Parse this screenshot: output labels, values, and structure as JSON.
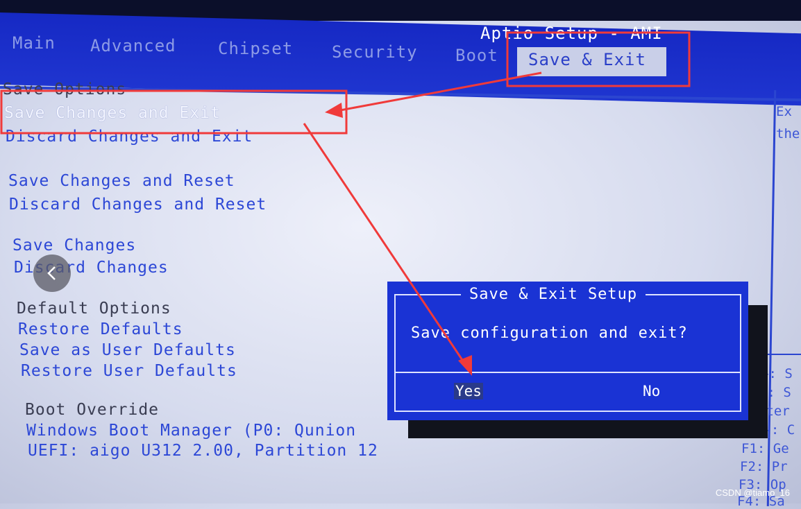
{
  "header": {
    "title": "Aptio Setup - AMI",
    "tabs": [
      "Main",
      "Advanced",
      "Chipset",
      "Security",
      "Boot",
      "Save & Exit"
    ],
    "active_tab": "Save & Exit"
  },
  "menu": {
    "save_options_header": "Save Options",
    "items": [
      "Save Changes and Exit",
      "Discard Changes and Exit",
      "Save Changes and Reset",
      "Discard Changes and Reset",
      "Save Changes",
      "Discard Changes"
    ],
    "default_options_header": "Default Options",
    "default_items": [
      "Restore Defaults",
      "Save as User Defaults",
      "Restore User Defaults"
    ],
    "boot_override_header": "Boot Override",
    "boot_items": [
      "Windows Boot Manager (P0: Qunion",
      "UEFI: aigo U312 2.00, Partition 12"
    ]
  },
  "help": {
    "description": [
      "Ex",
      "the"
    ],
    "keys": [
      "←: S",
      "↓: S",
      "nter",
      "/-: C",
      "F1: Ge",
      "F2: Pr",
      "F3: Op",
      "F4: Sa"
    ]
  },
  "dialog": {
    "title": "Save & Exit Setup",
    "message": "Save configuration and exit?",
    "yes": "Yes",
    "no": "No",
    "selected": "Yes"
  },
  "overlay": {
    "annotation_color": "#f03a3a",
    "watermark": "CSDN @tiamo_16",
    "nav_icon": "chevron-left-icon"
  },
  "colors": {
    "header_blue": "#1a2fc8",
    "item_blue": "#2c47d6",
    "dialog_blue": "#1a33d4"
  }
}
